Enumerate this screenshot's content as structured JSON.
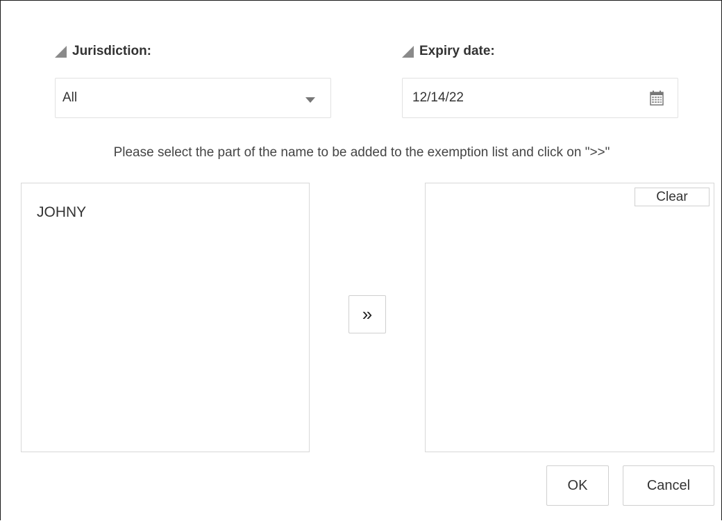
{
  "jurisdiction": {
    "label": "Jurisdiction:",
    "value": "All"
  },
  "expiry": {
    "label": "Expiry date:",
    "value": "12/14/22"
  },
  "instruction": "Please select the part of the name to be added to the exemption list and click on \">>\"",
  "source_list": {
    "items": [
      "JOHNY"
    ]
  },
  "move_button_label": "»",
  "exemption_list": {
    "items": [],
    "clear_label": "Clear"
  },
  "buttons": {
    "ok": "OK",
    "cancel": "Cancel"
  },
  "icons": {
    "field_marker": "triangle-icon",
    "dropdown": "chevron-down-icon",
    "date": "calendar-icon"
  }
}
